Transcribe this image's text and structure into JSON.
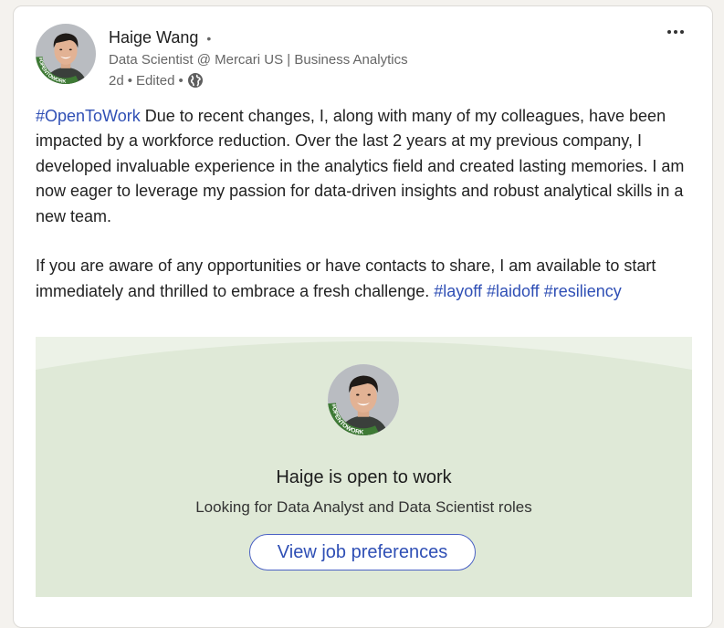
{
  "author": {
    "name": "Haige Wang",
    "name_suffix": "•",
    "headline": "Data Scientist @ Mercari US | Business Analytics",
    "time": "2d",
    "sep1": "•",
    "edited": "Edited",
    "sep2": "•",
    "badge_text": "#OPENTOWORK",
    "visibility_icon": "globe-icon"
  },
  "menu": {
    "icon": "more-horizontal-icon"
  },
  "post": {
    "p1_tag": "#OpenToWork",
    "p1_text": " Due to recent changes, I, along with many of my colleagues, have been impacted by a workforce reduction. Over the last 2 years at my previous company, I developed invaluable experience in the analytics field and created lasting memories. I am now eager to leverage my passion for data-driven insights and robust analytical skills in a new team.",
    "p2_text": "If you are aware of any opportunities or have contacts to share, I am available to start immediately and thrilled to embrace a fresh challenge. ",
    "tag_layoff": "#layoff",
    "tag_laidoff": "#laidoff",
    "tag_resiliency": "#resiliency"
  },
  "open_to_work": {
    "title": "Haige is open to work",
    "subtitle": "Looking for Data Analyst and Data Scientist roles",
    "button": "View job preferences",
    "badge_text": "#OPENTOWORK"
  },
  "colors": {
    "hashtag": "#2f4fb5",
    "otw_background": "#dfe9d7",
    "otw_badge_green": "#3e7a35"
  }
}
